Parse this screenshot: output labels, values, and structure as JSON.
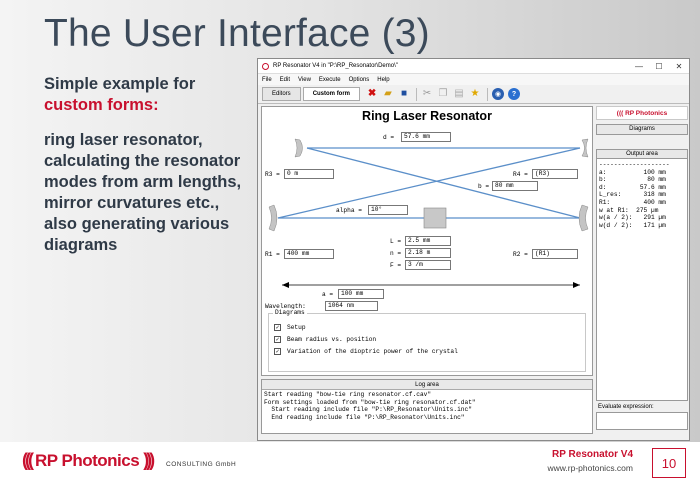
{
  "slide": {
    "title": "The User Interface (3)",
    "intro_line": "Simple example for",
    "intro_highlight": "custom forms:",
    "description": "ring laser resonator, calculating the resonator modes from arm lengths, mirror curvatures etc., also generating various diagrams"
  },
  "window": {
    "title": "RP Resonator V4 in \"P:\\RP_Resonator\\Demo\\\"",
    "controls": {
      "minimize": "—",
      "maximize": "☐",
      "close": "✕"
    },
    "menu": [
      "File",
      "Edit",
      "View",
      "Execute",
      "Options",
      "Help"
    ],
    "tabs": [
      "Editors",
      "Custom form"
    ]
  },
  "form": {
    "title": "Ring Laser Resonator",
    "d_label": "d =",
    "d_value": "57.6 mm",
    "r3_label": "R3 =",
    "r3_value": "0 m",
    "r4_label": "R4 =",
    "r4_value": "(R3)",
    "b_label": "b =",
    "b_value": "80 mm",
    "alpha_label": "alpha =",
    "alpha_value": "10°",
    "L_label": "L =",
    "L_value": "2.5 mm",
    "n_label": "n =",
    "n_value": "2.18 m",
    "F_label": "F =",
    "F_value": "3 /m",
    "r1_label": "R1 =",
    "r1_value": "400 mm",
    "r2_label": "R2 =",
    "r2_value": "(R1)",
    "a_label": "a =",
    "a_value": "100 mm",
    "wavelength_label": "Wavelength:",
    "wavelength_value": "1064 nm",
    "diagrams_legend": "Diagrams",
    "diagrams": [
      {
        "label": "Setup",
        "checked": true
      },
      {
        "label": "Beam radius vs. position",
        "checked": true
      },
      {
        "label": "Variation of the dioptric power of the crystal",
        "checked": true
      }
    ]
  },
  "log": {
    "bar_label": "Log area",
    "lines": [
      "Start reading \"bow-tie ring resonator.cf.cav\"",
      "Form settings loaded from \"bow-tie ring resonator.cf.dat\"",
      "  Start reading include file \"P:\\RP_Resonator\\Units.inc\"",
      "  End reading include file \"P:\\RP_Resonator\\Units.inc\""
    ]
  },
  "sidepanel": {
    "logo": "((( RP Photonics",
    "diagrams_button": "Diagrams",
    "output_label": "Output area",
    "output_lines": [
      "-------------------",
      "a:          100 mm",
      "b:           80 mm",
      "d:         57.6 mm",
      "L_res:      318 mm",
      "R1:         400 mm",
      "w at R1:  275 µm",
      "w(a / 2):   291 µm",
      "w(d / 2):   171 µm"
    ],
    "evaluate_label": "Evaluate expression:"
  },
  "footer": {
    "brand": "RP Photonics",
    "consulting": "CONSULTING GmbH",
    "product": "RP Resonator V4",
    "website": "www.rp-photonics.com",
    "page_number": "10"
  },
  "colors": {
    "accent_red": "#c8102e",
    "title_gray": "#3c4a5a",
    "beam_blue": "#5b8fc9"
  }
}
